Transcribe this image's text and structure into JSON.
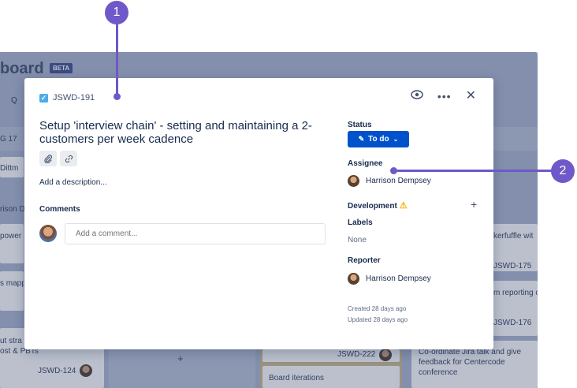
{
  "board": {
    "title": "board",
    "badge": "BETA",
    "fragments": {
      "search": "Q",
      "count": "G  17",
      "dittm": "Dittm",
      "rison": "rison D",
      "power": "power",
      "mapp": "s mapp",
      "strat": "ut stra",
      "pbts": "ost & PBTs",
      "key124": "JSWD-124",
      "key222": "JSWD-222",
      "board_iterations": "Board iterations",
      "kerfuffle": "kerfuffle wit",
      "key175": "JSWD-175",
      "reporting": "m reporting c",
      "key176": "JSWD-176",
      "coordinate": "Co-ordinate Jira talk and give feedback for Centercode conference",
      "plus": "+"
    }
  },
  "modal": {
    "issue_key": "JSWD-191",
    "summary": "Setup 'interview chain' - setting and maintaining a 2-customers per week cadence",
    "add_description": "Add a description...",
    "comments_heading": "Comments",
    "comment_placeholder": "Add a comment...",
    "status_label": "Status",
    "status_value": "To do",
    "assignee_label": "Assignee",
    "assignee_name": "Harrison Dempsey",
    "development_label": "Development",
    "labels_label": "Labels",
    "labels_value": "None",
    "reporter_label": "Reporter",
    "reporter_name": "Harrison Dempsey",
    "created": "Created 28 days ago",
    "updated": "Updated 28 days ago"
  },
  "icons": {
    "watch": "eye-icon",
    "more": "more-icon",
    "close": "close-icon",
    "attach": "paperclip-icon",
    "link": "link-icon",
    "warning": "warning-icon",
    "add": "plus-icon"
  },
  "callouts": [
    "1",
    "2"
  ],
  "colors": {
    "accent": "#0052CC",
    "callout": "#6F58C9",
    "warning": "#FFAB00"
  }
}
